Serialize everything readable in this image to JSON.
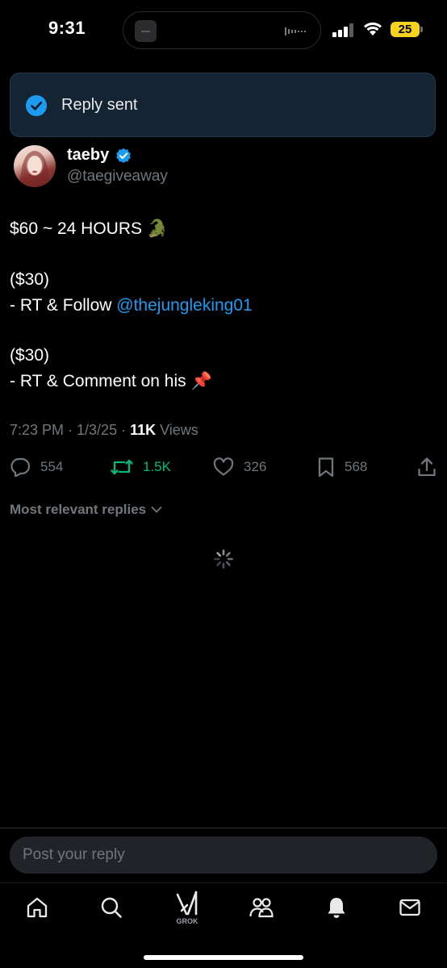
{
  "status_bar": {
    "time": "9:31",
    "battery": "25"
  },
  "toast": {
    "text": "Reply sent"
  },
  "post": {
    "author_name": "taeby",
    "author_handle": "@taegiveaway",
    "lines": {
      "l1": "$60 ~ 24 HOURS 🐊",
      "l2": "($30)",
      "l3_prefix": "- RT & Follow ",
      "l3_mention": "@thejungleking01",
      "l4": "($30)",
      "l5": "- RT & Comment on his 📌"
    },
    "time": "7:23 PM · 1/3/25 · ",
    "views_count": "11K",
    "views_label": " Views"
  },
  "actions": {
    "replies": "554",
    "reposts": "1.5K",
    "likes": "326",
    "bookmarks": "568"
  },
  "replies_sort": {
    "label": "Most relevant replies"
  },
  "composer": {
    "placeholder": "Post your reply"
  },
  "tabbar": {
    "grok_label": "GROK"
  },
  "colors": {
    "accent": "#1d9bf0",
    "repost": "#00ba7c",
    "muted": "#71767b"
  }
}
